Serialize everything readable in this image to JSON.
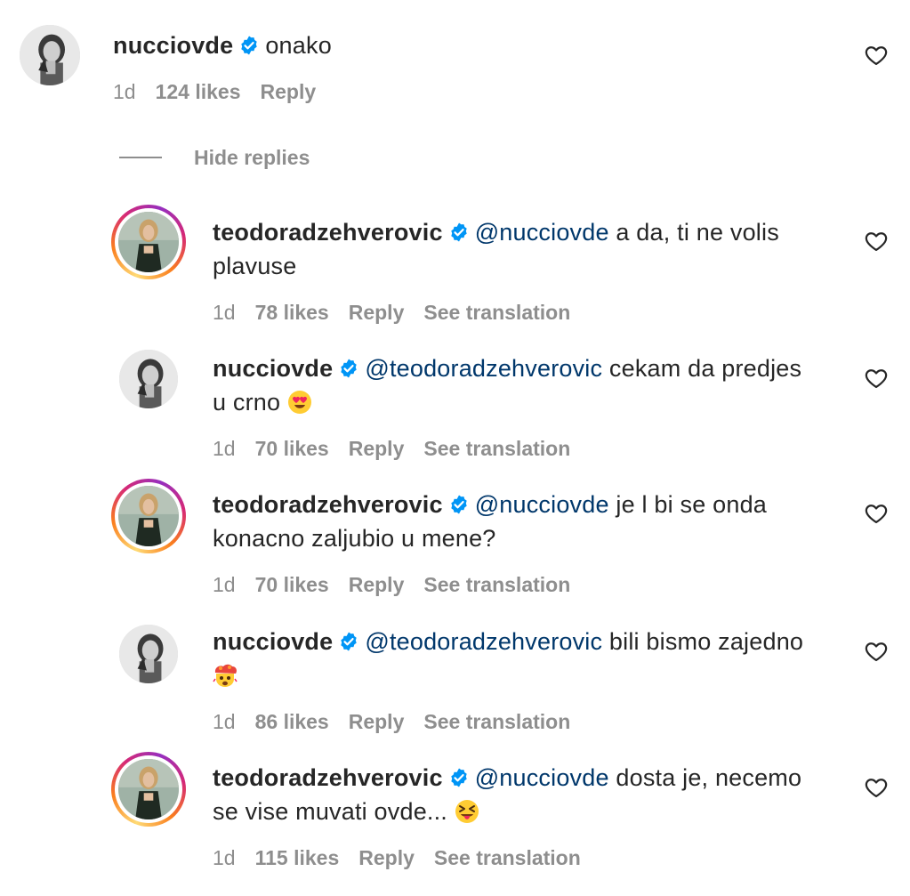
{
  "comments": [
    {
      "username": "nucciovde",
      "mention": "",
      "text": "onako",
      "age": "1d",
      "likes": "124 likes",
      "reply": "Reply",
      "see_translation": ""
    },
    {
      "username": "teodoradzehverovic",
      "mention": "@nucciovde",
      "text_line1": "a da, ti ne volis",
      "text_line2": "plavuse",
      "age": "1d",
      "likes": "78 likes",
      "reply": "Reply",
      "see_translation": "See translation"
    },
    {
      "username": "nucciovde",
      "mention": "@teodoradzehverovic",
      "text_line1": "cekam da predjes",
      "text_line2": "u crno",
      "emoji": "smiling-face-heart-eyes",
      "age": "1d",
      "likes": "70 likes",
      "reply": "Reply",
      "see_translation": "See translation"
    },
    {
      "username": "teodoradzehverovic",
      "mention": "@nucciovde",
      "text_line1": "je l bi se onda",
      "text_line2": "konacno zaljubio u mene?",
      "age": "1d",
      "likes": "70 likes",
      "reply": "Reply",
      "see_translation": "See translation"
    },
    {
      "username": "nucciovde",
      "mention": "@teodoradzehverovic",
      "text_line1": "bili bismo zajedno",
      "text_line2": "",
      "emoji": "exploding-head",
      "age": "1d",
      "likes": "86 likes",
      "reply": "Reply",
      "see_translation": "See translation"
    },
    {
      "username": "teodoradzehverovic",
      "mention": "@nucciovde",
      "text_line1": "dosta je, necemo",
      "text_line2": "se vise muvati ovde...",
      "emoji": "squinting-face-tongue",
      "age": "1d",
      "likes": "115 likes",
      "reply": "Reply",
      "see_translation": "See translation"
    }
  ],
  "hide_replies": "Hide replies",
  "colors": {
    "text": "#262626",
    "meta": "#8e8e8e",
    "mention": "#00376b",
    "verified": "#0095f6"
  }
}
